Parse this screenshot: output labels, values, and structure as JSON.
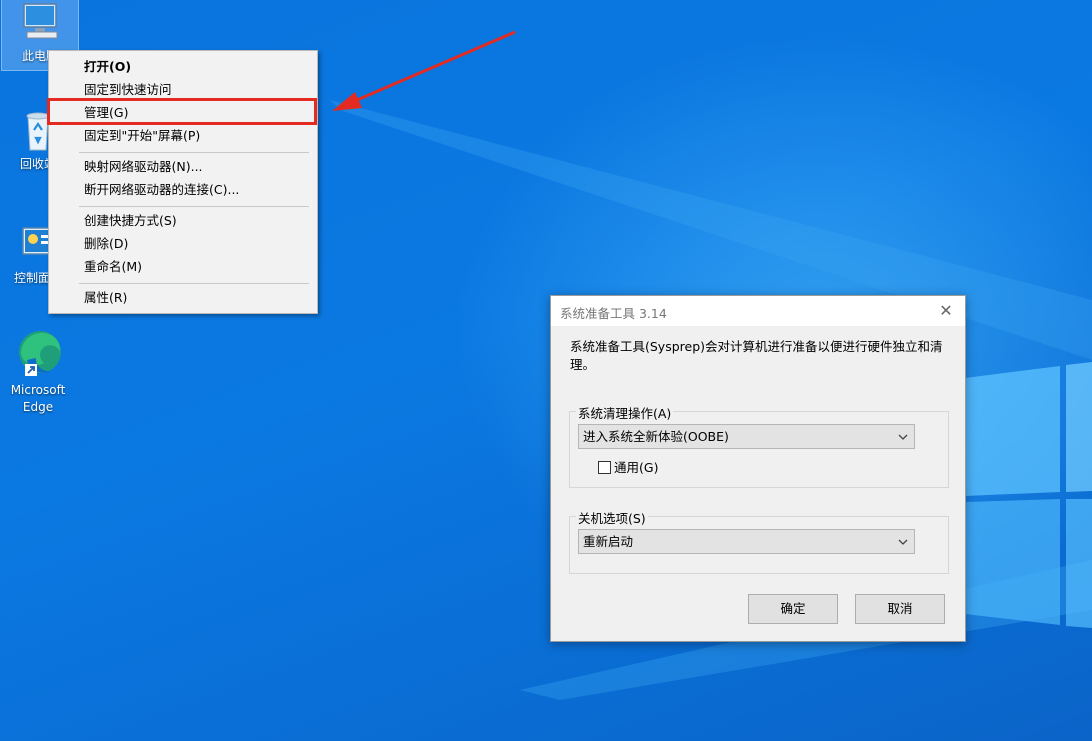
{
  "desktop": {
    "icons": [
      {
        "label": "此电脑",
        "icon": "this-pc-icon"
      },
      {
        "label": "回收站",
        "icon": "recycle-bin-icon"
      },
      {
        "label": "控制面板",
        "icon": "control-panel-icon"
      },
      {
        "label": "Microsoft Edge",
        "icon": "edge-icon"
      }
    ]
  },
  "context_menu": {
    "items": [
      {
        "label": "打开(O)"
      },
      {
        "label": "固定到快速访问"
      },
      {
        "label": "管理(G)"
      },
      {
        "label": "固定到\"开始\"屏幕(P)"
      },
      {
        "label": "映射网络驱动器(N)..."
      },
      {
        "label": "断开网络驱动器的连接(C)..."
      },
      {
        "label": "创建快捷方式(S)"
      },
      {
        "label": "删除(D)"
      },
      {
        "label": "重命名(M)"
      },
      {
        "label": "属性(R)"
      }
    ],
    "highlight_color": "#e32b22"
  },
  "dialog": {
    "title": "系统准备工具 3.14",
    "description": "系统准备工具(Sysprep)会对计算机进行准备以便进行硬件独立和清理。",
    "cleanup_group": {
      "legend": "系统清理操作(A)",
      "selected": "进入系统全新体验(OOBE)",
      "checkbox_label": "通用(G)",
      "checkbox_checked": false
    },
    "shutdown_group": {
      "legend": "关机选项(S)",
      "selected": "重新启动"
    },
    "ok_label": "确定",
    "cancel_label": "取消"
  }
}
